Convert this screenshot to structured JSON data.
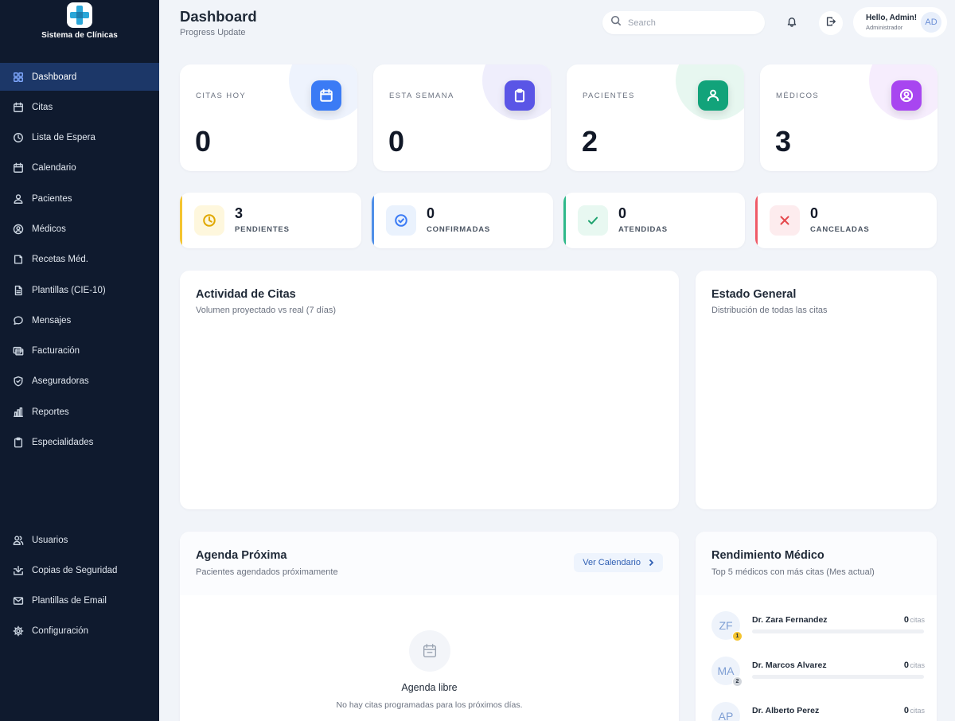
{
  "app": {
    "name": "Sistema de Clínicas"
  },
  "sidebar": {
    "items": [
      {
        "label": "Dashboard",
        "icon": "grid-icon",
        "active": true
      },
      {
        "label": "Citas",
        "icon": "calendar-icon"
      },
      {
        "label": "Lista de Espera",
        "icon": "clock-icon"
      },
      {
        "label": "Calendario",
        "icon": "calendar-icon"
      },
      {
        "label": "Pacientes",
        "icon": "users-icon"
      },
      {
        "label": "Médicos",
        "icon": "user-circle-icon"
      },
      {
        "label": "Recetas Méd.",
        "icon": "book-icon"
      },
      {
        "label": "Plantillas (CIE-10)",
        "icon": "file-icon"
      },
      {
        "label": "Mensajes",
        "icon": "chat-icon"
      },
      {
        "label": "Facturación",
        "icon": "billing-icon"
      },
      {
        "label": "Aseguradoras",
        "icon": "shield-icon"
      },
      {
        "label": "Reportes",
        "icon": "bar-chart-icon"
      },
      {
        "label": "Especialidades",
        "icon": "clipboard-icon"
      }
    ],
    "bottom_items": [
      {
        "label": "Usuarios",
        "icon": "users-icon"
      },
      {
        "label": "Copias de Seguridad",
        "icon": "download-icon"
      },
      {
        "label": "Plantillas de Email",
        "icon": "mail-icon"
      },
      {
        "label": "Configuración",
        "icon": "gear-icon"
      }
    ]
  },
  "header": {
    "title": "Dashboard",
    "subtitle": "Progress Update",
    "search_placeholder": "Search",
    "user_greeting": "Hello, Admin!",
    "user_role": "Administrador",
    "user_initials": "AD"
  },
  "stats": [
    {
      "label": "CITAS HOY",
      "value": "0",
      "color": "#3b7bf5",
      "icon": "calendar-icon"
    },
    {
      "label": "ESTA SEMANA",
      "value": "0",
      "color": "#5a55e6",
      "icon": "clipboard-icon"
    },
    {
      "label": "PACIENTES",
      "value": "2",
      "color": "#12a37a",
      "icon": "users-icon"
    },
    {
      "label": "MÉDICOS",
      "value": "3",
      "color": "#a846f0",
      "icon": "user-circle-icon"
    }
  ],
  "statuses": [
    {
      "value": "3",
      "label": "PENDIENTES",
      "color": "#f4c430",
      "icon": "clock-icon"
    },
    {
      "value": "0",
      "label": "CONFIRMADAS",
      "color": "#4f8fe8",
      "icon": "check-circle-icon"
    },
    {
      "value": "0",
      "label": "ATENDIDAS",
      "color": "#2fb98a",
      "icon": "check-icon"
    },
    {
      "value": "0",
      "label": "CANCELADAS",
      "color": "#ef5a67",
      "icon": "x-icon"
    }
  ],
  "activity": {
    "title": "Actividad de Citas",
    "subtitle": "Volumen proyectado vs real (7 días)"
  },
  "status_general": {
    "title": "Estado General",
    "subtitle": "Distribución de todas las citas"
  },
  "agenda": {
    "title": "Agenda Próxima",
    "subtitle": "Pacientes agendados próximamente",
    "button_label": "Ver Calendario",
    "empty_title": "Agenda libre",
    "empty_subtitle": "No hay citas programadas para los próximos días."
  },
  "performance": {
    "title": "Rendimiento Médico",
    "subtitle": "Top 5 médicos con más citas (Mes actual)",
    "unit": "citas",
    "doctors": [
      {
        "initials": "ZF",
        "rank": "1",
        "name": "Dr. Zara Fernandez",
        "count": "0",
        "rank_color": "#f4c430"
      },
      {
        "initials": "MA",
        "rank": "2",
        "name": "Dr. Marcos Alvarez",
        "count": "0",
        "rank_color": "#d1d5db"
      },
      {
        "initials": "AP",
        "rank": "",
        "name": "Dr. Alberto Perez",
        "count": "0",
        "rank_color": ""
      }
    ]
  }
}
